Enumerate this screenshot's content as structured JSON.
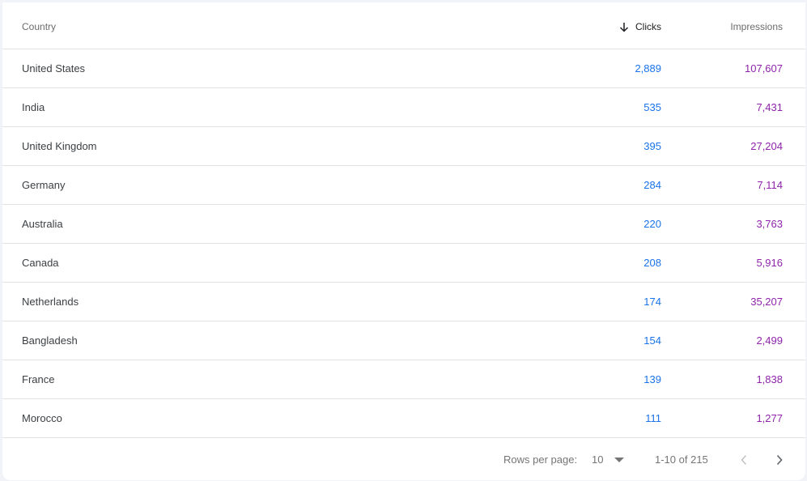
{
  "table": {
    "columns": {
      "country": "Country",
      "clicks": "Clicks",
      "impressions": "Impressions"
    },
    "sort": {
      "column": "clicks",
      "direction": "descending",
      "icon": "arrow-down-icon"
    },
    "rows": [
      {
        "country": "United States",
        "clicks": "2,889",
        "impressions": "107,607"
      },
      {
        "country": "India",
        "clicks": "535",
        "impressions": "7,431"
      },
      {
        "country": "United Kingdom",
        "clicks": "395",
        "impressions": "27,204"
      },
      {
        "country": "Germany",
        "clicks": "284",
        "impressions": "7,114"
      },
      {
        "country": "Australia",
        "clicks": "220",
        "impressions": "3,763"
      },
      {
        "country": "Canada",
        "clicks": "208",
        "impressions": "5,916"
      },
      {
        "country": "Netherlands",
        "clicks": "174",
        "impressions": "35,207"
      },
      {
        "country": "Bangladesh",
        "clicks": "154",
        "impressions": "2,499"
      },
      {
        "country": "France",
        "clicks": "139",
        "impressions": "1,838"
      },
      {
        "country": "Morocco",
        "clicks": "111",
        "impressions": "1,277"
      }
    ]
  },
  "pagination": {
    "rows_per_page_label": "Rows per page:",
    "rows_per_page_value": "10",
    "range": "1-10 of 215",
    "prev_icon": "chevron-left-icon",
    "next_icon": "chevron-right-icon"
  },
  "colors": {
    "clicks": "#1a73e8",
    "impressions": "#8e24aa",
    "divider": "#e3e3e3"
  }
}
